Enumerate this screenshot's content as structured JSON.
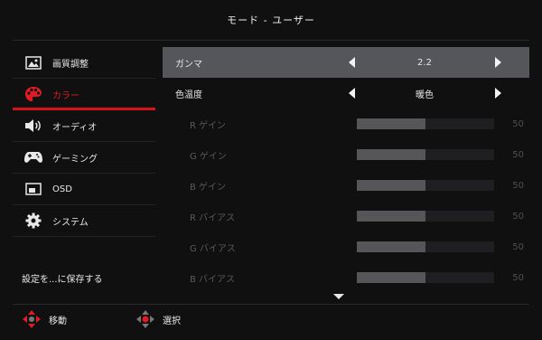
{
  "title": "モード - ユーザー",
  "sidebar": {
    "items": [
      {
        "label": "画質調整",
        "icon": "picture-icon",
        "active": false
      },
      {
        "label": "カラー",
        "icon": "palette-icon",
        "active": true
      },
      {
        "label": "オーディオ",
        "icon": "speaker-icon",
        "active": false
      },
      {
        "label": "ゲーミング",
        "icon": "gamepad-icon",
        "active": false
      },
      {
        "label": "OSD",
        "icon": "osd-icon",
        "active": false
      },
      {
        "label": "システム",
        "icon": "gear-icon",
        "active": false
      }
    ],
    "save_label": "設定を...に保存する"
  },
  "main": {
    "gamma": {
      "label": "ガンマ",
      "value": "2.2"
    },
    "color_temp": {
      "label": "色温度",
      "value": "暖色"
    },
    "gains": [
      {
        "label": "R ゲイン",
        "value": "50"
      },
      {
        "label": "G ゲイン",
        "value": "50"
      },
      {
        "label": "B ゲイン",
        "value": "50"
      },
      {
        "label": "R バイアス",
        "value": "50"
      },
      {
        "label": "G バイアス",
        "value": "50"
      },
      {
        "label": "B バイアス",
        "value": "50"
      }
    ],
    "bar_fraction": 0.5
  },
  "footer": {
    "move_label": "移動",
    "select_label": "選択"
  },
  "colors": {
    "accent": "#d8121a",
    "selected_row": "#555659"
  }
}
